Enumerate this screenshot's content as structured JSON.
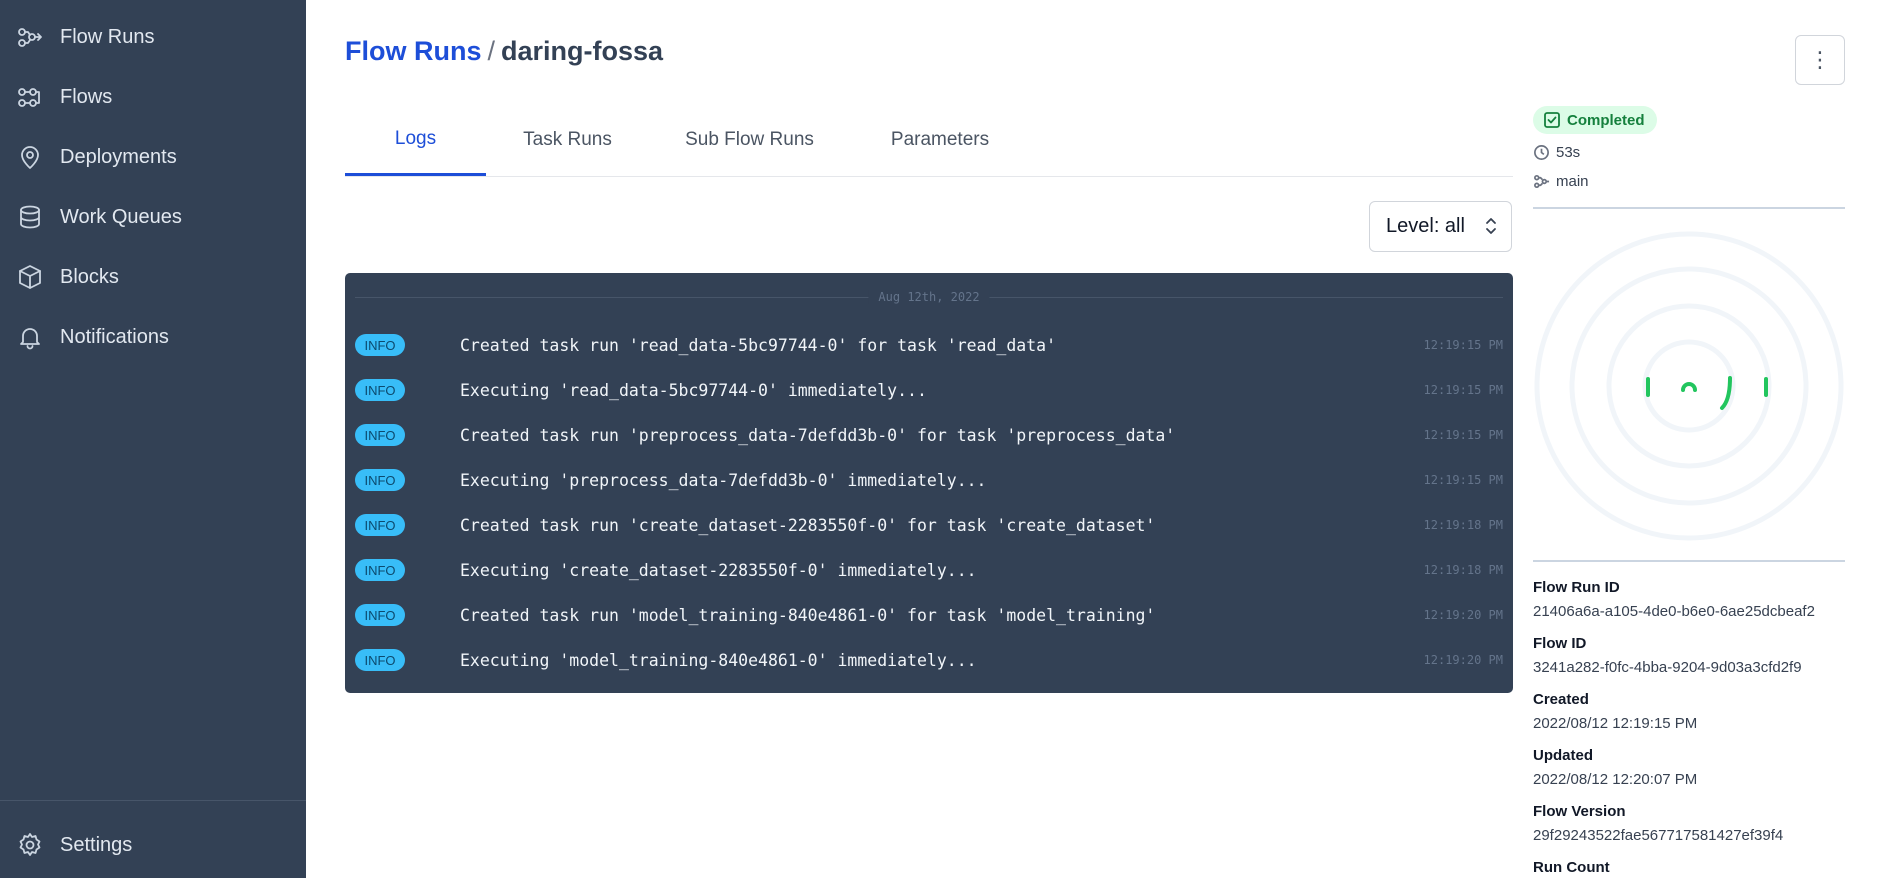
{
  "sidebar": {
    "items": [
      {
        "label": "Flow Runs",
        "icon": "flow-runs-icon"
      },
      {
        "label": "Flows",
        "icon": "flows-icon"
      },
      {
        "label": "Deployments",
        "icon": "map-pin-icon"
      },
      {
        "label": "Work Queues",
        "icon": "database-icon"
      },
      {
        "label": "Blocks",
        "icon": "cube-icon"
      },
      {
        "label": "Notifications",
        "icon": "bell-icon"
      }
    ],
    "settings_label": "Settings"
  },
  "breadcrumb": {
    "parent": "Flow Runs",
    "separator": "/",
    "current": "daring-fossa"
  },
  "tabs": [
    "Logs",
    "Task Runs",
    "Sub Flow Runs",
    "Parameters"
  ],
  "active_tab": "Logs",
  "level_filter": {
    "label": "Level: all"
  },
  "logs": {
    "date": "Aug 12th, 2022",
    "entries": [
      {
        "level": "INFO",
        "message": "Created task run 'read_data-5bc97744-0' for task 'read_data'",
        "time": "12:19:15 PM"
      },
      {
        "level": "INFO",
        "message": "Executing 'read_data-5bc97744-0' immediately...",
        "time": "12:19:15 PM"
      },
      {
        "level": "INFO",
        "message": "Created task run 'preprocess_data-7defdd3b-0' for task 'preprocess_data'",
        "time": "12:19:15 PM"
      },
      {
        "level": "INFO",
        "message": "Executing 'preprocess_data-7defdd3b-0' immediately...",
        "time": "12:19:15 PM"
      },
      {
        "level": "INFO",
        "message": "Created task run 'create_dataset-2283550f-0' for task 'create_dataset'",
        "time": "12:19:18 PM"
      },
      {
        "level": "INFO",
        "message": "Executing 'create_dataset-2283550f-0' immediately...",
        "time": "12:19:18 PM"
      },
      {
        "level": "INFO",
        "message": "Created task run 'model_training-840e4861-0' for task 'model_training'",
        "time": "12:19:20 PM"
      },
      {
        "level": "INFO",
        "message": "Executing 'model_training-840e4861-0' immediately...",
        "time": "12:19:20 PM"
      }
    ]
  },
  "run_info": {
    "state": "Completed",
    "duration": "53s",
    "flow_name": "main"
  },
  "details": {
    "flow_run_id_label": "Flow Run ID",
    "flow_run_id": "21406a6a-a105-4de0-b6e0-6ae25dcbeaf2",
    "flow_id_label": "Flow ID",
    "flow_id": "3241a282-f0fc-4bba-9204-9d03a3cfd2f9",
    "created_label": "Created",
    "created": "2022/08/12 12:19:15 PM",
    "updated_label": "Updated",
    "updated": "2022/08/12 12:20:07 PM",
    "flow_version_label": "Flow Version",
    "flow_version": "29f29243522fae567717581427ef39f4",
    "run_count_label": "Run Count"
  },
  "colors": {
    "sidebar_bg": "#334155",
    "accent": "#1d4ed8",
    "success": "#22c55e",
    "info_badge": "#38bdf8"
  }
}
